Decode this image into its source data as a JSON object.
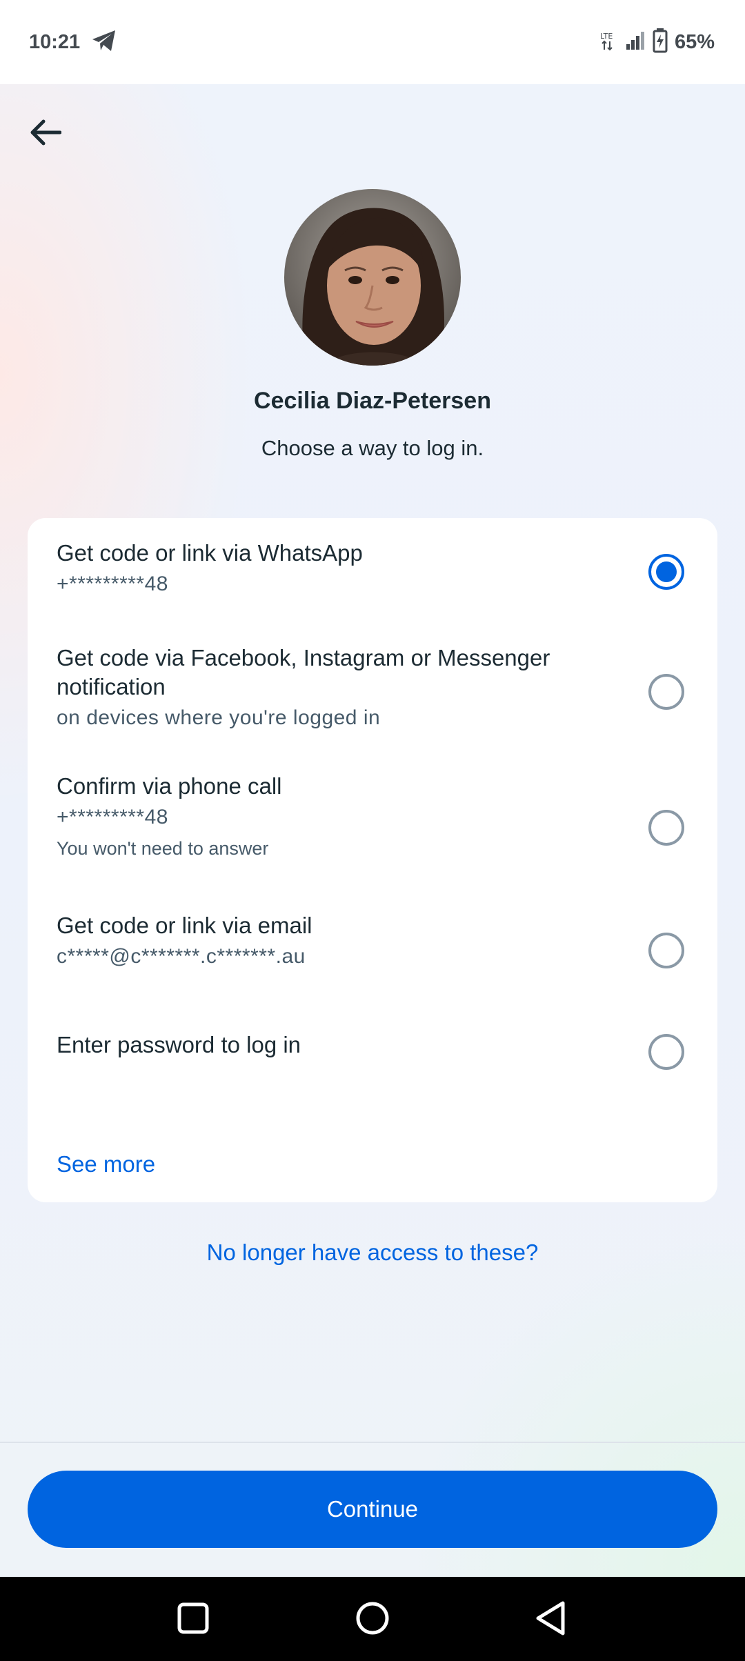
{
  "status_bar": {
    "time": "10:21",
    "battery": "65%",
    "icons": [
      "telegram-icon",
      "lte-icon",
      "signal-icon",
      "battery-charging-icon"
    ]
  },
  "header": {
    "back_icon": "arrow-left-icon"
  },
  "profile": {
    "name": "Cecilia Diaz-Petersen",
    "subtitle": "Choose a way to log in."
  },
  "options": [
    {
      "title": "Get code or link via WhatsApp",
      "sub": "+*********48",
      "selected": true
    },
    {
      "title": "Get code via Facebook, Instagram or Messenger notification",
      "sub": "on devices where you're logged in",
      "selected": false
    },
    {
      "title": "Confirm via phone call",
      "sub": "+*********48",
      "note": "You won't need to answer",
      "selected": false
    },
    {
      "title": "Get code or link via email",
      "sub": "c*****@c*******.c*******.au",
      "selected": false
    },
    {
      "title": "Enter password to log in",
      "selected": false
    }
  ],
  "see_more": "See more",
  "no_access": "No longer have access to these?",
  "continue_label": "Continue",
  "colors": {
    "accent": "#0064e0",
    "text_primary": "#1c2b33",
    "text_secondary": "#465a69"
  }
}
